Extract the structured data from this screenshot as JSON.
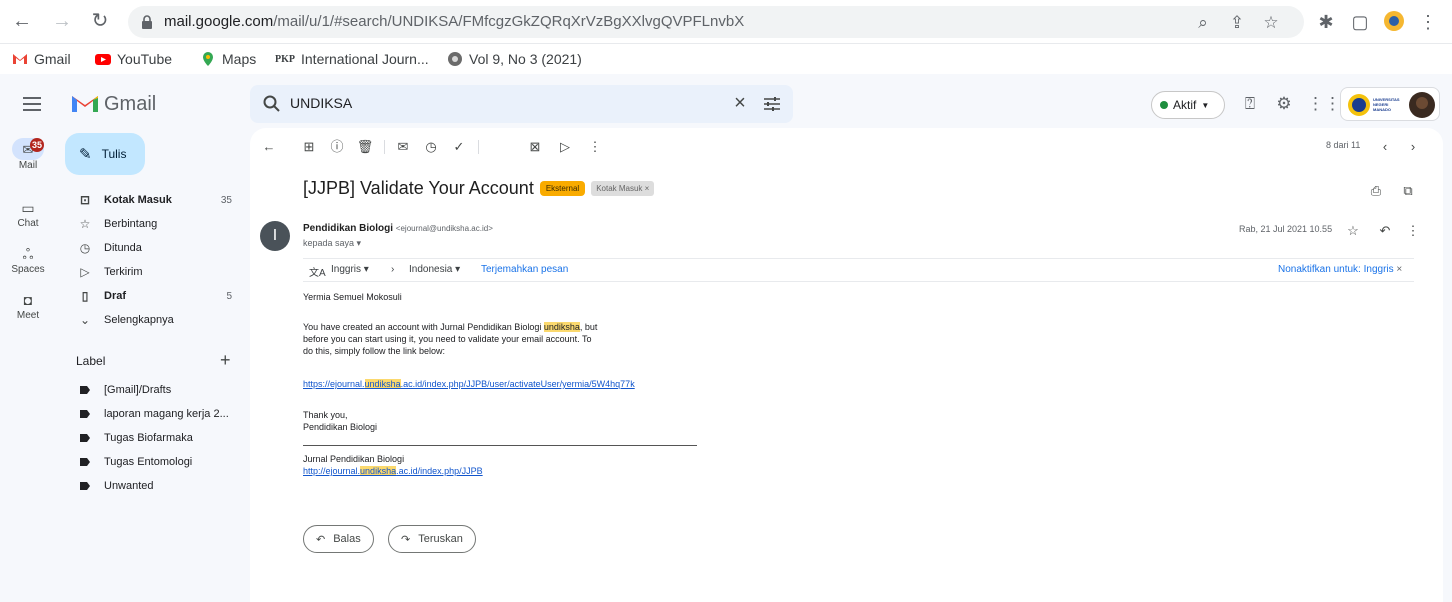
{
  "browser": {
    "url_host": "mail.google.com",
    "url_path": "/mail/u/1/#search/UNDIKSA/FMfcgzGkZQRqXrVzBgXXlvgQVPFLnvbX"
  },
  "bookmarks": [
    {
      "label": "Gmail"
    },
    {
      "label": "YouTube"
    },
    {
      "label": "Maps"
    },
    {
      "label": "International Journ...",
      "prefix": "PKP"
    },
    {
      "label": "Vol 9, No 3 (2021)"
    }
  ],
  "gmail": {
    "logo_text": "Gmail",
    "search_value": "UNDIKSA",
    "status_label": "Aktif",
    "account_label": "UNIVERSITAS NEGERI MANADO"
  },
  "rail": {
    "mail_label": "Mail",
    "mail_badge": "35",
    "chat_label": "Chat",
    "spaces_label": "Spaces",
    "meet_label": "Meet"
  },
  "nav": {
    "compose_label": "Tulis",
    "items": [
      {
        "label": "Kotak Masuk",
        "count": "35",
        "bold": true
      },
      {
        "label": "Berbintang",
        "count": ""
      },
      {
        "label": "Ditunda",
        "count": ""
      },
      {
        "label": "Terkirim",
        "count": ""
      },
      {
        "label": "Draf",
        "count": "5",
        "bold": true
      },
      {
        "label": "Selengkapnya",
        "count": ""
      }
    ],
    "labels_heading": "Label",
    "labels": [
      "[Gmail]/Drafts",
      "laporan magang kerja 2...",
      "Tugas Biofarmaka",
      "Tugas Entomologi",
      "Unwanted"
    ]
  },
  "email": {
    "pager": "8 dari 11",
    "subject": "[JJPB] Validate Your Account",
    "chip_external": "Eksternal",
    "chip_inbox": "Kotak Masuk ×",
    "avatar_letter": "I",
    "sender_name": "Pendidikan Biologi",
    "sender_email": "<ejournal@undiksha.ac.id>",
    "to_line": "kepada saya ▾",
    "date": "Rab, 21 Jul 2021 10.55",
    "translate": {
      "from_lang": "Inggris",
      "to_lang": "Indonesia",
      "translate_link": "Terjemahkan pesan",
      "disable_link": "Nonaktifkan untuk: Inggris"
    },
    "greeting": "Yermia Semuel Mokosuli",
    "para_1a": "You have created an account with Jurnal Pendidikan Biologi ",
    "para_1_hl": "undiksha",
    "para_1b": ", but",
    "para_2": "before you can start using it, you need to validate your email account. To",
    "para_3": "do this, simply follow the link below:",
    "link_a": "https://ejournal.",
    "link_hl": "undiksha",
    "link_b": ".ac.id/index.php/JJPB/user/activateUser/yermia/5W4hq77k",
    "thanks": "Thank you,",
    "signature_name": "Pendidikan Biologi",
    "journal_name": "Jurnal Pendidikan Biologi",
    "journal_link_a": "http://ejournal.",
    "journal_link_hl": "undiksha",
    "journal_link_b": ".ac.id/index.php/JJPB",
    "reply_label": "Balas",
    "forward_label": "Teruskan"
  }
}
